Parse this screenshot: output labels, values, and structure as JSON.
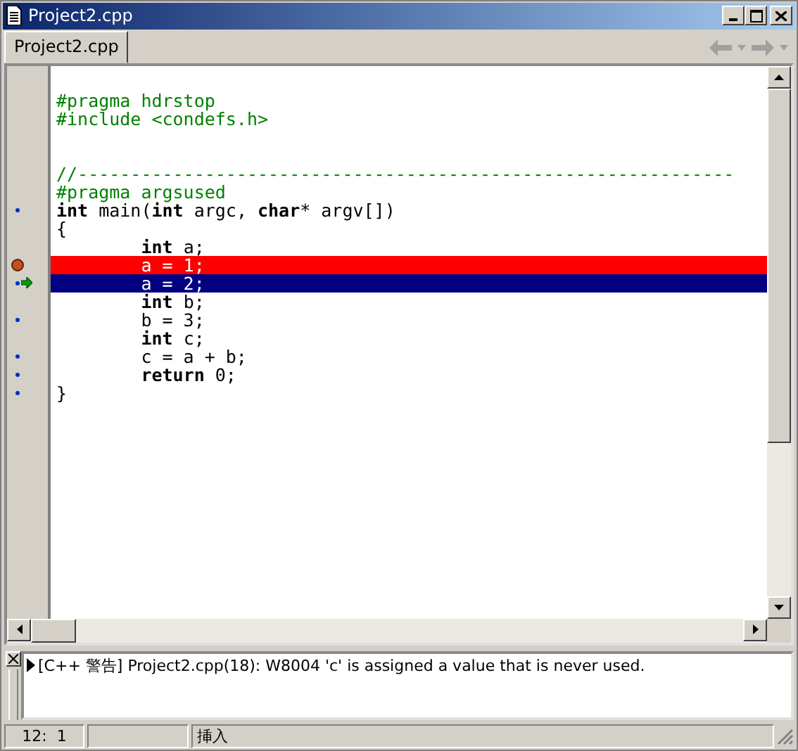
{
  "window": {
    "title": "Project2.cpp"
  },
  "tabs": [
    {
      "label": "Project2.cpp",
      "selected": true
    }
  ],
  "editor": {
    "lines": [
      {
        "kind": "blank",
        "dot": false,
        "breakpoint": false,
        "execution": false
      },
      {
        "kind": "directive",
        "text": "#pragma hdrstop",
        "dot": false,
        "breakpoint": false,
        "execution": false
      },
      {
        "kind": "directive",
        "text": "#include <condefs.h>",
        "dot": false,
        "breakpoint": false,
        "execution": false
      },
      {
        "kind": "blank",
        "dot": false,
        "breakpoint": false,
        "execution": false
      },
      {
        "kind": "blank",
        "dot": false,
        "breakpoint": false,
        "execution": false
      },
      {
        "kind": "comment",
        "text": "//--------------------------------------------------------------",
        "dot": false,
        "breakpoint": false,
        "execution": false
      },
      {
        "kind": "directive",
        "text": "#pragma argsused",
        "dot": false,
        "breakpoint": false,
        "execution": false
      },
      {
        "kind": "code",
        "text": "**int** main(**int** argc, **char*** argv[])",
        "dot": true,
        "breakpoint": false,
        "execution": false
      },
      {
        "kind": "code",
        "text": "{",
        "dot": false,
        "breakpoint": false,
        "execution": false
      },
      {
        "kind": "code",
        "text": "        **int** a;",
        "dot": false,
        "breakpoint": false,
        "execution": false
      },
      {
        "kind": "code",
        "text": "        a = 1;",
        "dot": false,
        "breakpoint": true,
        "execution": false
      },
      {
        "kind": "code",
        "text": "        a = 2;",
        "dot": true,
        "breakpoint": false,
        "execution": true
      },
      {
        "kind": "code",
        "text": "        **int** b;",
        "dot": false,
        "breakpoint": false,
        "execution": false
      },
      {
        "kind": "code",
        "text": "        b = 3;",
        "dot": true,
        "breakpoint": false,
        "execution": false
      },
      {
        "kind": "code",
        "text": "        **int** c;",
        "dot": false,
        "breakpoint": false,
        "execution": false
      },
      {
        "kind": "code",
        "text": "        c = a + b;",
        "dot": true,
        "breakpoint": false,
        "execution": false
      },
      {
        "kind": "code",
        "text": "        **return** 0;",
        "dot": true,
        "breakpoint": false,
        "execution": false
      },
      {
        "kind": "code",
        "text": "}",
        "dot": true,
        "breakpoint": false,
        "execution": false
      }
    ]
  },
  "messages": [
    {
      "text": "[C++ 警告] Project2.cpp(18): W8004 'c' is assigned a value that is never used."
    }
  ],
  "status_bar": {
    "position": "12:  1",
    "mode": "挿入"
  }
}
